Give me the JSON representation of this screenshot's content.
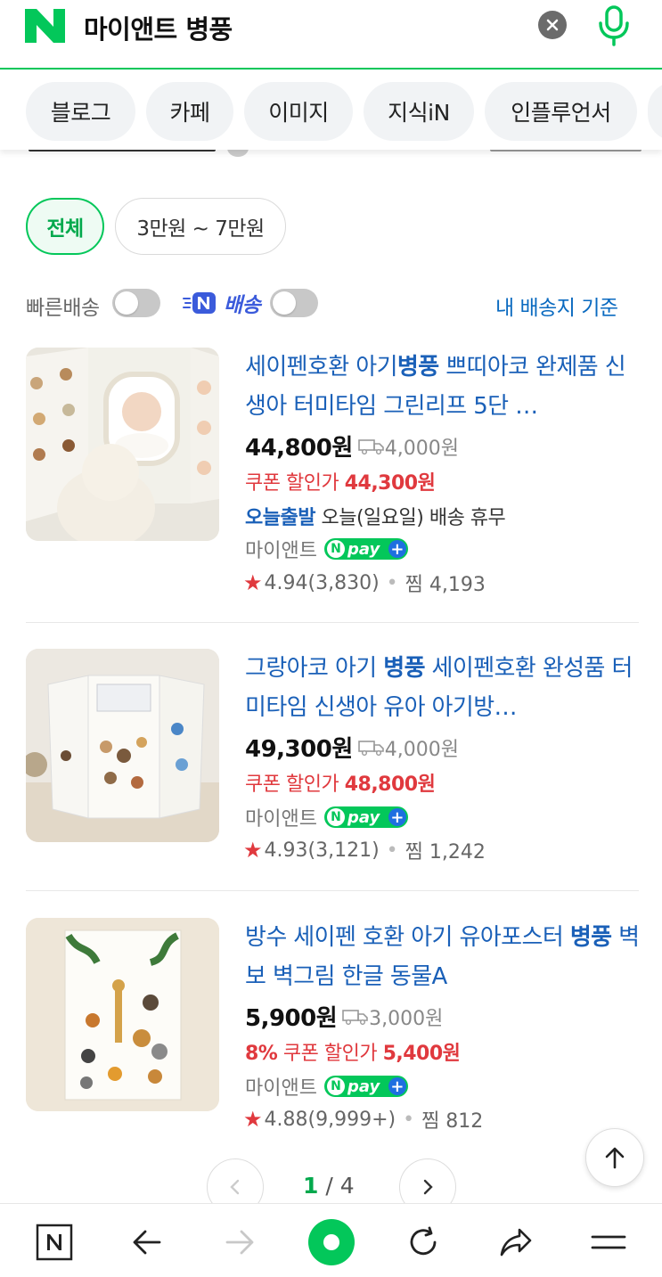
{
  "search": {
    "query": "마이앤트 병풍",
    "brand_color": "#03c75a"
  },
  "tabs": [
    "블로그",
    "카페",
    "이미지",
    "지식iN",
    "인플루언서"
  ],
  "filters": {
    "all": "전체",
    "range": "3만원 ~ 7만원"
  },
  "options": {
    "fast_delivery": "빠른배송",
    "npay_delivery": "배송",
    "my_address": "내 배송지 기준"
  },
  "products": [
    {
      "title_pre": "세이펜호환 아기",
      "title_kw": "병풍",
      "title_post": " 쁘띠아코 완제품 신생아 터미타임 그린리프 5단 …",
      "price": "44,800원",
      "shipping": "4,000원",
      "coupon_label": "쿠폰 할인가",
      "coupon_price": "44,300원",
      "today_label": "오늘출발",
      "today_text": "오늘(일요일) 배송 휴무",
      "seller": "마이앤트",
      "rating": "4.94",
      "reviews": "(3,830)",
      "wish": "찜 4,193"
    },
    {
      "title_pre": "그랑아코 아기 ",
      "title_kw": "병풍",
      "title_post": " 세이펜호환 완성품 터미타임 신생아 유아 아기방…",
      "price": "49,300원",
      "shipping": "4,000원",
      "coupon_label": "쿠폰 할인가",
      "coupon_price": "48,800원",
      "seller": "마이앤트",
      "rating": "4.93",
      "reviews": "(3,121)",
      "wish": "찜 1,242"
    },
    {
      "title_pre": "방수 세이펜 호환 아기 유아포스터 ",
      "title_kw": "병풍",
      "title_post": " 벽보 벽그림 한글 동물A",
      "price": "5,900원",
      "shipping": "3,000원",
      "coupon_pct": "8%",
      "coupon_label": "쿠폰 할인가",
      "coupon_price": "5,400원",
      "seller": "마이앤트",
      "rating": "4.88",
      "reviews": "(9,999+)",
      "wish": "찜 812"
    }
  ],
  "pagination": {
    "current": "1",
    "separator": "/",
    "total": "4"
  },
  "bottom_bar": [
    "naver-home-icon",
    "back-arrow-icon",
    "forward-arrow-icon",
    "green-dot-icon",
    "refresh-icon",
    "share-icon",
    "menu-icon"
  ]
}
